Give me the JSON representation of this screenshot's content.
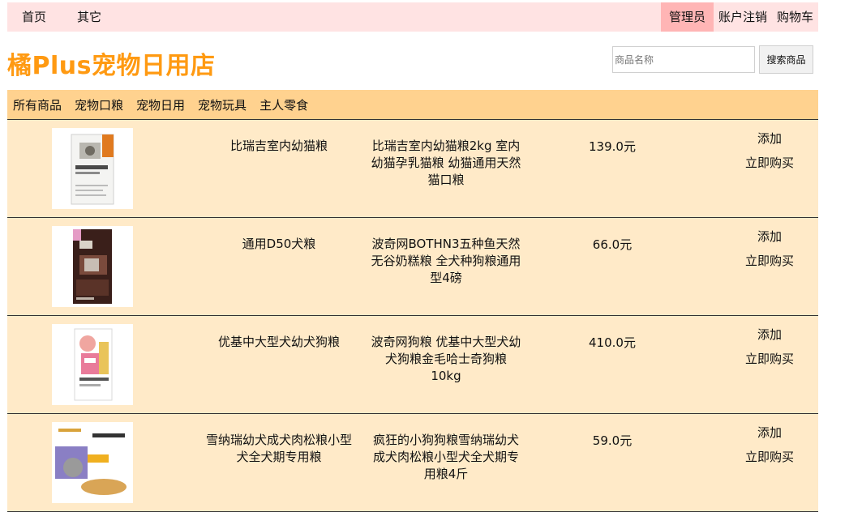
{
  "topnav": {
    "home": "首页",
    "other": "其它",
    "admin": "管理员",
    "logout": "账户注销",
    "cart": "购物车"
  },
  "header": {
    "brand": "橘Plus宠物日用店",
    "search_placeholder": "商品名称",
    "search_button": "搜索商品"
  },
  "categories": [
    "所有商品",
    "宠物口粮",
    "宠物日用",
    "宠物玩具",
    "主人零食"
  ],
  "products": [
    {
      "name": "比瑞吉室内幼猫粮",
      "desc": "比瑞吉室内幼猫粮2kg 室内幼猫孕乳猫粮 幼猫通用天然猫口粮",
      "price": "139.0元",
      "add": "添加",
      "buy": "立即购买"
    },
    {
      "name": "通用D50犬粮",
      "desc": "波奇网BOTHN3五种鱼天然无谷奶糕粮 全犬种狗粮通用型4磅",
      "price": "66.0元",
      "add": "添加",
      "buy": "立即购买"
    },
    {
      "name": "优基中大型犬幼犬狗粮",
      "desc": "波奇网狗粮 优基中大型犬幼犬狗粮金毛哈士奇狗粮10kg",
      "price": "410.0元",
      "add": "添加",
      "buy": "立即购买"
    },
    {
      "name": "雪纳瑞幼犬成犬肉松粮小型犬全犬期专用粮",
      "desc": "疯狂的小狗狗粮雪纳瑞幼犬成犬肉松粮小型犬全犬期专用粮4斤",
      "price": "59.0元",
      "add": "添加",
      "buy": "立即购买"
    }
  ],
  "colors": {
    "topnav_bg": "#ffe3e3",
    "admin_bg": "#ffb5b5",
    "brand": "#ff9a12",
    "catbar_bg": "#ffd28f",
    "list_bg": "#ffeac8"
  }
}
